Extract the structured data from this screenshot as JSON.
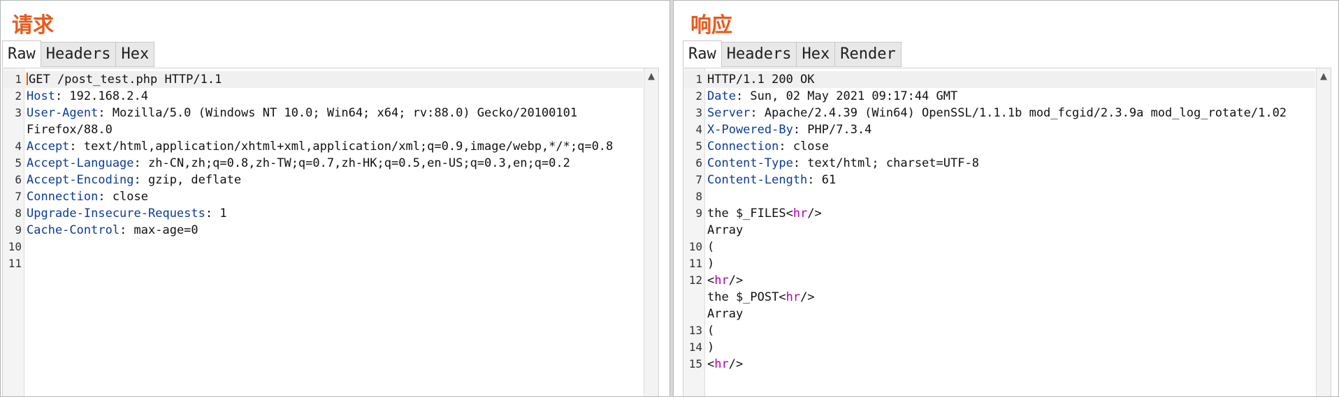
{
  "request": {
    "title": "请求",
    "tabs": [
      "Raw",
      "Headers",
      "Hex"
    ],
    "active_tab": "Raw",
    "lines": [
      {
        "num": "1",
        "name": "",
        "value": "GET /post_test.php HTTP/1.1"
      },
      {
        "num": "2",
        "name": "Host",
        "value": ": 192.168.2.4"
      },
      {
        "num": "3",
        "name": "User-Agent",
        "value": ": Mozilla/5.0 (Windows NT 10.0; Win64; x64; rv:88.0) Gecko/20100101"
      },
      {
        "num": "",
        "name": "",
        "value": "Firefox/88.0"
      },
      {
        "num": "4",
        "name": "Accept",
        "value": ": text/html,application/xhtml+xml,application/xml;q=0.9,image/webp,*/*;q=0.8"
      },
      {
        "num": "5",
        "name": "Accept-Language",
        "value": ": zh-CN,zh;q=0.8,zh-TW;q=0.7,zh-HK;q=0.5,en-US;q=0.3,en;q=0.2"
      },
      {
        "num": "6",
        "name": "Accept-Encoding",
        "value": ": gzip, deflate"
      },
      {
        "num": "7",
        "name": "Connection",
        "value": ": close"
      },
      {
        "num": "8",
        "name": "Upgrade-Insecure-Requests",
        "value": ": 1"
      },
      {
        "num": "9",
        "name": "Cache-Control",
        "value": ": max-age=0"
      },
      {
        "num": "10",
        "name": "",
        "value": ""
      },
      {
        "num": "11",
        "name": "",
        "value": ""
      }
    ]
  },
  "response": {
    "title": "响应",
    "tabs": [
      "Raw",
      "Headers",
      "Hex",
      "Render"
    ],
    "active_tab": "Raw",
    "lines": [
      {
        "num": "1",
        "name": "",
        "value": "HTTP/1.1 200 OK"
      },
      {
        "num": "2",
        "name": "Date",
        "value": ": Sun, 02 May 2021 09:17:44 GMT"
      },
      {
        "num": "3",
        "name": "Server",
        "value": ": Apache/2.4.39 (Win64) OpenSSL/1.1.1b mod_fcgid/2.3.9a mod_log_rotate/1.02"
      },
      {
        "num": "4",
        "name": "X-Powered-By",
        "value": ": PHP/7.3.4"
      },
      {
        "num": "5",
        "name": "Connection",
        "value": ": close"
      },
      {
        "num": "6",
        "name": "Content-Type",
        "value": ": text/html; charset=UTF-8"
      },
      {
        "num": "7",
        "name": "Content-Length",
        "value": ": 61"
      },
      {
        "num": "8",
        "name": "",
        "value": ""
      },
      {
        "num": "9",
        "parts": [
          "the $_FILES<",
          "hr",
          "/>"
        ]
      },
      {
        "num": "",
        "parts": [
          "Array"
        ]
      },
      {
        "num": "10",
        "parts": [
          "("
        ]
      },
      {
        "num": "11",
        "parts": [
          ")"
        ]
      },
      {
        "num": "12",
        "parts": [
          "<",
          "hr",
          "/>"
        ]
      },
      {
        "num": "",
        "parts": [
          "the $_POST<",
          "hr",
          "/>"
        ]
      },
      {
        "num": "",
        "parts": [
          "Array"
        ]
      },
      {
        "num": "13",
        "parts": [
          "("
        ]
      },
      {
        "num": "14",
        "parts": [
          ")"
        ]
      },
      {
        "num": "15",
        "parts": [
          "<",
          "hr",
          "/>"
        ]
      }
    ]
  },
  "icons": {
    "scroll_up": "▲"
  },
  "colors": {
    "title": "#e85a1b",
    "header_name": "#0a3c9a",
    "html_tag": "#b000b0",
    "caret": "#e06000"
  }
}
